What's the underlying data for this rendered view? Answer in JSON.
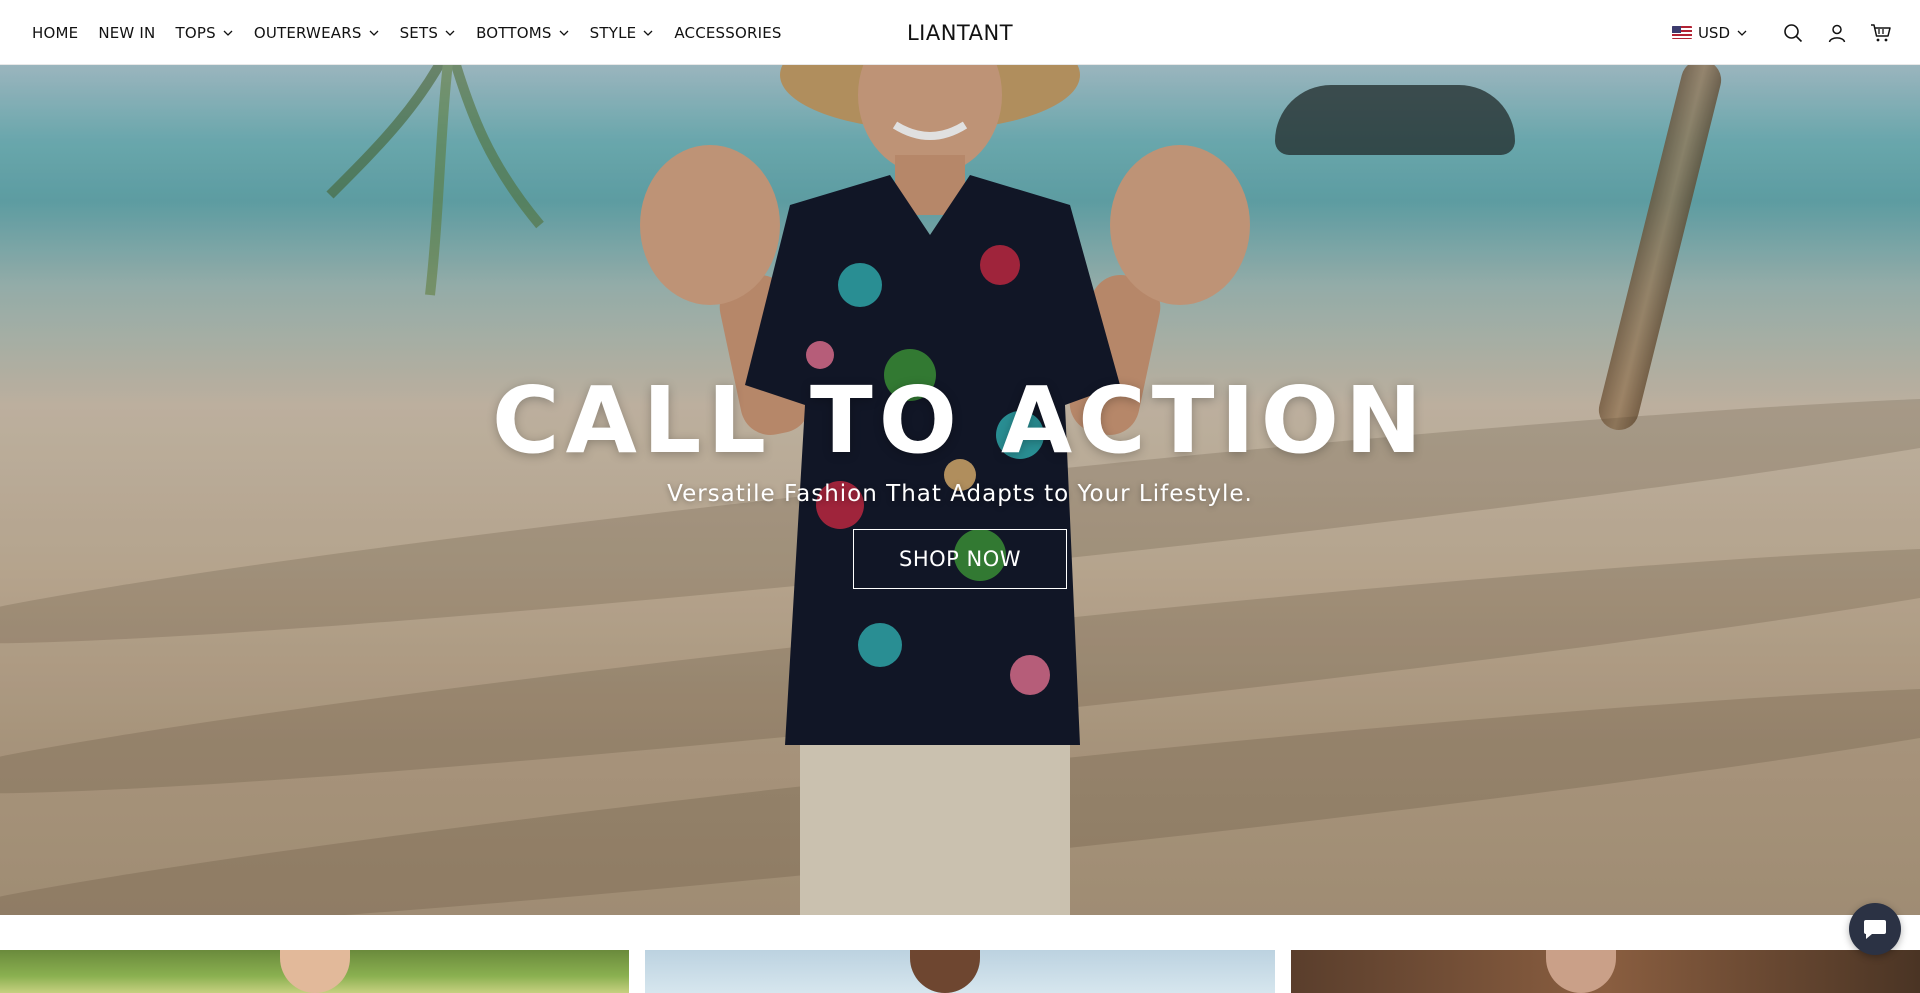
{
  "header": {
    "nav": [
      {
        "label": "HOME",
        "has_dropdown": false
      },
      {
        "label": "NEW IN",
        "has_dropdown": false
      },
      {
        "label": "TOPS",
        "has_dropdown": true
      },
      {
        "label": "OUTERWEARS",
        "has_dropdown": true
      },
      {
        "label": "SETS",
        "has_dropdown": true
      },
      {
        "label": "BOTTOMS",
        "has_dropdown": true
      },
      {
        "label": "STYLE",
        "has_dropdown": true
      },
      {
        "label": "ACCESSORIES",
        "has_dropdown": false
      }
    ],
    "logo": "LIANTANT",
    "currency": "USD",
    "icons": [
      "search-icon",
      "account-icon",
      "cart-icon"
    ]
  },
  "hero": {
    "title": "CALL TO ACTION",
    "subtitle": "Versatile Fashion That Adapts to Your Lifestyle.",
    "cta_label": "SHOP NOW"
  },
  "chat": {
    "icon": "chat-icon"
  },
  "colors": {
    "text": "#121212",
    "header_bg": "#ffffff",
    "hero_text": "#ffffff",
    "chat_bg": "#2b3244"
  }
}
